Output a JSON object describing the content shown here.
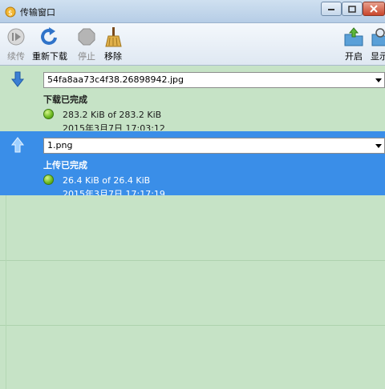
{
  "window": {
    "title": "传输窗口"
  },
  "toolbar": {
    "resume": "续传",
    "redownload": "重新下载",
    "stop": "停止",
    "remove": "移除",
    "open": "开启",
    "show": "显示"
  },
  "transfers": [
    {
      "direction": "download",
      "filename": "54fa8aa73c4f38.26898942.jpg",
      "status": "下载已完成",
      "size": "283.2 KiB of 283.2 KiB",
      "date": "2015年3月7日 17:03:12"
    },
    {
      "direction": "upload",
      "filename": "1.png",
      "status": "上传已完成",
      "size": "26.4 KiB of 26.4 KiB",
      "date": "2015年3月7日 17:17:19"
    }
  ],
  "colors": {
    "background": "#c6e3c6",
    "selected": "#3a8ee8"
  }
}
